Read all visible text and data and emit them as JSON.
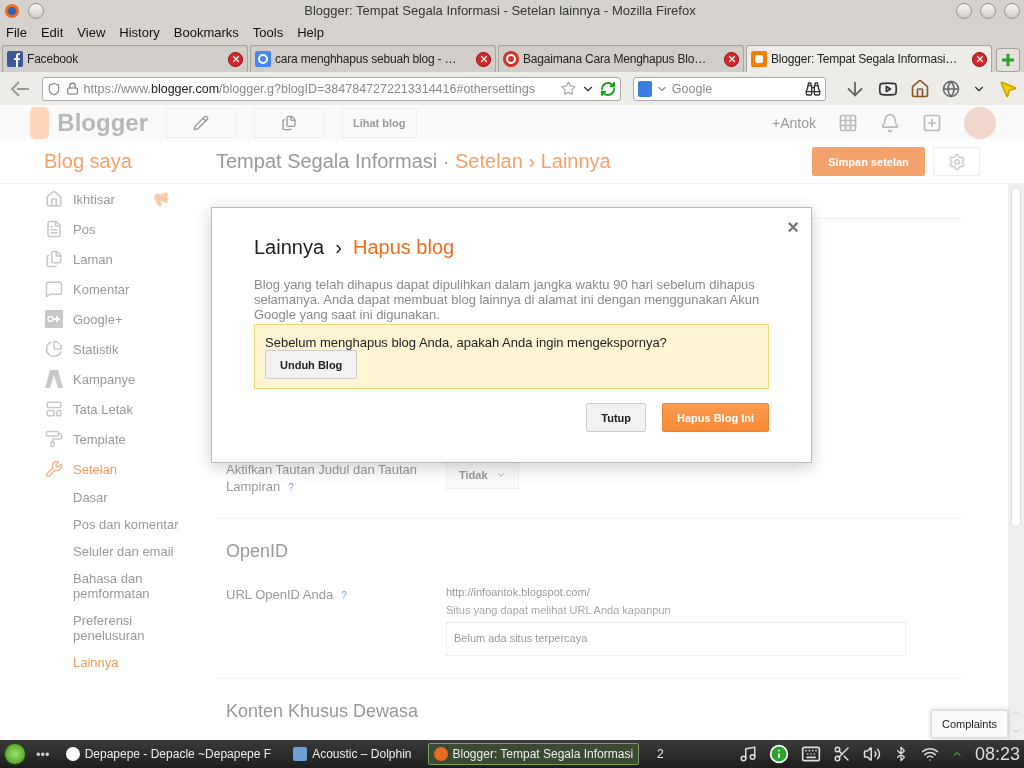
{
  "window": {
    "title": "Blogger: Tempat Segala Informasi - Setelan lainnya - Mozilla Firefox"
  },
  "menu": [
    "File",
    "Edit",
    "View",
    "History",
    "Bookmarks",
    "Tools",
    "Help"
  ],
  "tabs": [
    {
      "label": "Facebook",
      "selected": false
    },
    {
      "label": "cara menghhapus sebuah blog - …",
      "selected": false
    },
    {
      "label": "Bagaimana Cara Menghapus Blo…",
      "selected": false
    },
    {
      "label": "Blogger: Tempat Segala Informasi…",
      "selected": true
    }
  ],
  "address": {
    "prefix": "https://www.",
    "host": "blogger.com",
    "path": "/blogger.g?blogID=3847847272213314416#othersettings"
  },
  "search": {
    "placeholder": "Google"
  },
  "blogger_header": {
    "logo": "Blogger",
    "view_blog": "Lihat blog",
    "user": "+Antok"
  },
  "page_header": {
    "my_blogs": "Blog saya",
    "blog_title": "Tempat Segala Informasi",
    "dot": "·",
    "section": "Setelan",
    "arrow": "›",
    "page": "Lainnya",
    "save": "Simpan setelan"
  },
  "sidebar": {
    "items": [
      {
        "label": "Ikhtisar",
        "selected": false
      },
      {
        "label": "Pos",
        "selected": false
      },
      {
        "label": "Laman",
        "selected": false
      },
      {
        "label": "Komentar",
        "selected": false
      },
      {
        "label": "Google+",
        "selected": false
      },
      {
        "label": "Statistik",
        "selected": false
      },
      {
        "label": "Kampanye",
        "selected": false
      },
      {
        "label": "Tata Letak",
        "selected": false
      },
      {
        "label": "Template",
        "selected": false
      },
      {
        "label": "Setelan",
        "selected": true,
        "children": [
          {
            "label": "Dasar",
            "selected": false
          },
          {
            "label": "Pos dan komentar",
            "selected": false
          },
          {
            "label": "Seluler dan email",
            "selected": false
          },
          {
            "label": "Bahasa dan pemformatan",
            "selected": false
          },
          {
            "label": "Preferensi penelusuran",
            "selected": false
          },
          {
            "label": "Lainnya",
            "selected": true
          }
        ]
      }
    ]
  },
  "settings": [
    {
      "kind": "select_row",
      "label": "Aktifkan Tautan Judul dan Tautan Lampiran",
      "help": "?",
      "value": "Tidak"
    },
    {
      "kind": "heading",
      "text": "OpenID"
    },
    {
      "kind": "openid_row",
      "label": "URL OpenID Anda",
      "help": "?",
      "url": "http://infoantok.blogspot.com/",
      "note": "Situs yang dapat melihat URL Anda kapanpun",
      "list_placeholder": "Belum ada situs terpercaya"
    },
    {
      "kind": "heading",
      "text": "Konten Khusus Dewasa"
    }
  ],
  "dialog": {
    "parent": "Lainnya",
    "arrow": "›",
    "title": "Hapus blog",
    "close": "×",
    "body": "Blog yang telah dihapus dapat dipulihkan dalam jangka waktu 90 hari sebelum dihapus selamanya. Anda dapat membuat blog lainnya di alamat ini dengan menggunakan Akun Google yang saat ini digunakan.",
    "warning": "Sebelum menghapus blog Anda, apakah Anda ingin mengekspornya?",
    "download": "Unduh Blog",
    "cancel": "Tutup",
    "confirm": "Hapus Blog Ini"
  },
  "complaints": "Complaints",
  "taskbar": {
    "dots": "•••",
    "tasks": [
      {
        "label": "Depapepe - Depacle ~Depapepe F",
        "selected": false
      },
      {
        "label": "Acoustic – Dolphin",
        "selected": false
      },
      {
        "label": "Blogger: Tempat Segala Informasi",
        "selected": true
      }
    ],
    "desktop": "2",
    "clock": "08:23"
  }
}
